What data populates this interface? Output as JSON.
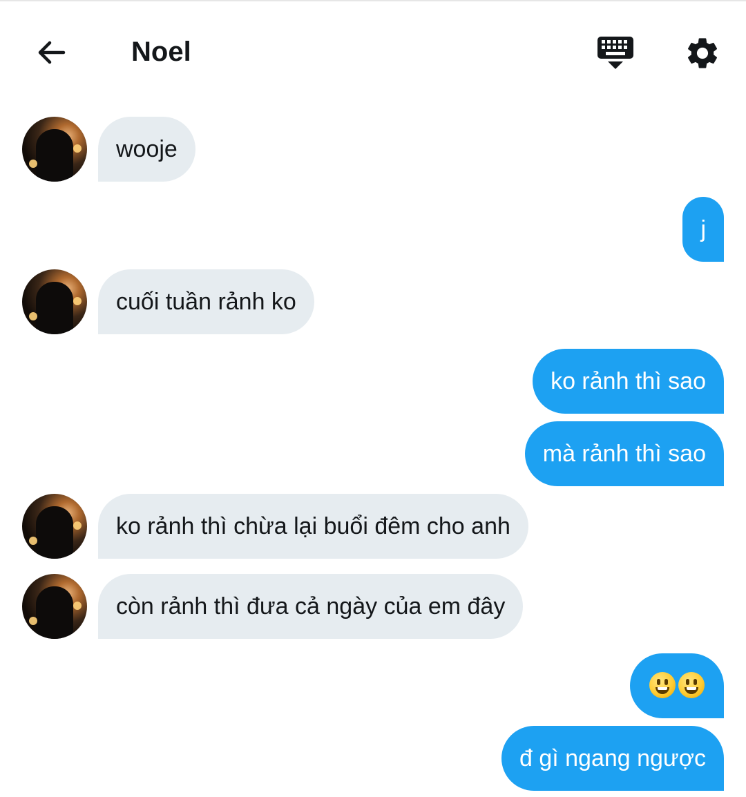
{
  "header": {
    "title": "Noel",
    "back_icon": "arrow-left-icon",
    "keyboard_icon": "keyboard-icon",
    "settings_icon": "gear-icon"
  },
  "colors": {
    "incoming_bubble": "#e6ecf0",
    "outgoing_bubble": "#1da1f2",
    "text_dark": "#14171a",
    "text_light": "#ffffff"
  },
  "messages": [
    {
      "direction": "in",
      "text": "wooje",
      "has_avatar": true
    },
    {
      "direction": "out",
      "text": "j"
    },
    {
      "direction": "in",
      "text": "cuối tuần rảnh ko",
      "has_avatar": true
    },
    {
      "direction": "out",
      "text": "ko rảnh thì sao"
    },
    {
      "direction": "out",
      "text": "mà rảnh thì sao"
    },
    {
      "direction": "in",
      "text": "ko rảnh thì chừa lại buổi đêm cho anh",
      "has_avatar": true
    },
    {
      "direction": "in",
      "text": "còn rảnh thì đưa cả ngày của em đây",
      "has_avatar": true
    },
    {
      "direction": "out",
      "emoji": [
        "smiling-face-icon",
        "smiling-face-icon"
      ]
    },
    {
      "direction": "out",
      "text": "đ gì ngang ngược"
    }
  ]
}
